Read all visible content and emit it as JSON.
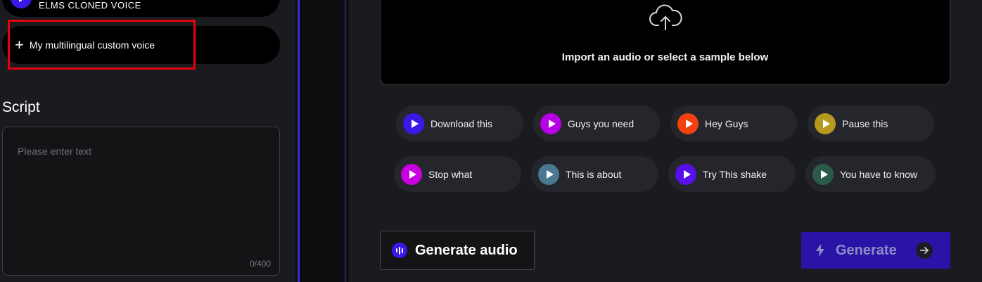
{
  "voices": {
    "top_label": "ELMS CLONED VOICE",
    "custom_label": "My multilingual custom voice"
  },
  "script": {
    "title": "Script",
    "placeholder": "Please enter text",
    "counter": "0/400"
  },
  "upload": {
    "text": "Import an audio or select a sample below"
  },
  "samples": [
    {
      "label": "Download this",
      "color": "#3a18e8"
    },
    {
      "label": "Guys you need",
      "color": "#b800e6"
    },
    {
      "label": "Hey Guys",
      "color": "#f2400f"
    },
    {
      "label": "Pause this",
      "color": "#b59a1e"
    },
    {
      "label": "Stop what",
      "color": "#c800e0"
    },
    {
      "label": "This is about",
      "color": "#4a7890"
    },
    {
      "label": "Try This shake",
      "color": "#5810e8"
    },
    {
      "label": "You have to know",
      "color": "#2c5a48"
    }
  ],
  "actions": {
    "generate_audio": "Generate audio",
    "generate": "Generate"
  }
}
